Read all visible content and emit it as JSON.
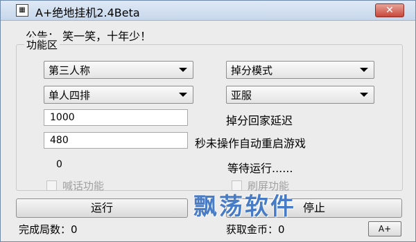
{
  "window": {
    "title": "A+绝地挂机2.4Beta",
    "icon": "app-icon",
    "close_label": "✕"
  },
  "notice": "公告： 笑一笑，十年少！",
  "group": {
    "title": "功能区",
    "view_combo": "第三人称",
    "mode_combo": "掉分模式",
    "team_combo": "单人四排",
    "server_combo": "亚服",
    "delay_value": "1000",
    "delay_label": "掉分回家延迟",
    "idle_value": "480",
    "idle_label": "秒未操作自动重启游戏",
    "counter": "0",
    "status": "等待运行......",
    "shout_label": "喊话功能",
    "brush_label": "刷屏功能"
  },
  "buttons": {
    "run": "运行",
    "stop": "停止",
    "about": "A+"
  },
  "footer": {
    "rounds": "完成局数：0",
    "gold": "获取金币：0"
  },
  "watermark": "飘荡软件"
}
